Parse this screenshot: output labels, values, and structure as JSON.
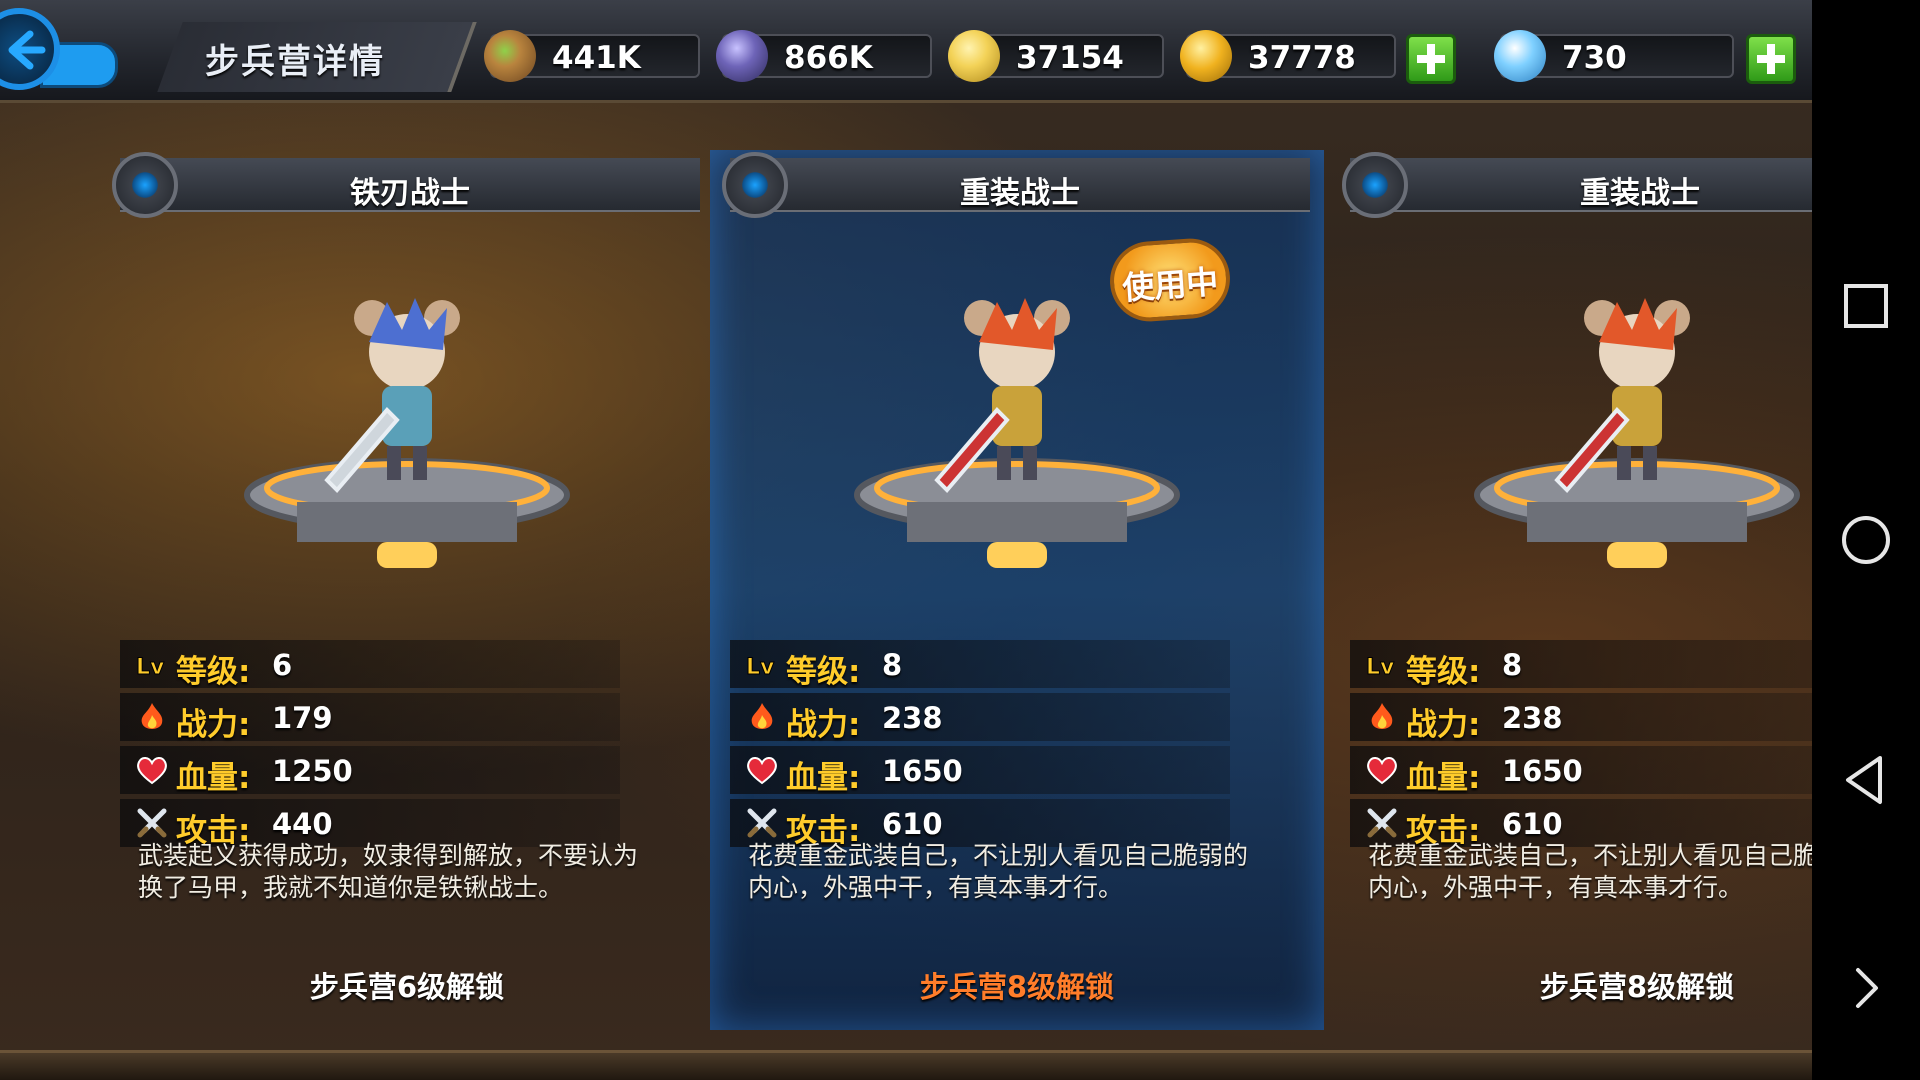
{
  "header": {
    "title": "步兵营详情"
  },
  "resources": [
    {
      "name": "wood",
      "value": "441K",
      "color": "#b9843e"
    },
    {
      "name": "ore",
      "value": "866K",
      "color": "#6e64b8"
    },
    {
      "name": "cheese",
      "value": "37154",
      "color": "#f3d257"
    },
    {
      "name": "gold",
      "value": "37778",
      "color": "#f0b21f"
    },
    {
      "name": "diamond",
      "value": "730",
      "color": "#7fd0ff"
    }
  ],
  "cards": [
    {
      "name": "铁刃战士",
      "in_use": false,
      "stats": [
        {
          "icon": "level-icon",
          "label": "等级",
          "value": "6"
        },
        {
          "icon": "flame-icon",
          "label": "战力",
          "value": "179"
        },
        {
          "icon": "heart-icon",
          "label": "血量",
          "value": "1250"
        },
        {
          "icon": "swords-icon",
          "label": "攻击",
          "value": "440"
        }
      ],
      "description": "武装起义获得成功，奴隶得到解放，不要认为换了马甲，我就不知道你是铁锹战士。",
      "unlock": "步兵营6级解锁"
    },
    {
      "name": "重装战士",
      "in_use": true,
      "in_use_label": "使用中",
      "stats": [
        {
          "icon": "level-icon",
          "label": "等级",
          "value": "8"
        },
        {
          "icon": "flame-icon",
          "label": "战力",
          "value": "238"
        },
        {
          "icon": "heart-icon",
          "label": "血量",
          "value": "1650"
        },
        {
          "icon": "swords-icon",
          "label": "攻击",
          "value": "610"
        }
      ],
      "description": "花费重金武装自己，不让别人看见自己脆弱的内心，外强中干，有真本事才行。",
      "unlock": "步兵营8级解锁"
    },
    {
      "name": "重装战士",
      "in_use": false,
      "stats": [
        {
          "icon": "level-icon",
          "label": "等级",
          "value": "8"
        },
        {
          "icon": "flame-icon",
          "label": "战力",
          "value": "238"
        },
        {
          "icon": "heart-icon",
          "label": "血量",
          "value": "1650"
        },
        {
          "icon": "swords-icon",
          "label": "攻击",
          "value": "610"
        }
      ],
      "description": "花费重金武装自己，不让别人看见自己脆弱的内心，外强中干，有真本事才行。",
      "unlock": "步兵营8级解锁"
    }
  ],
  "level_badge": "Lv",
  "colon": ":",
  "nav": {
    "icons": [
      "recent-apps-icon",
      "home-icon",
      "back-icon",
      "expand-icon"
    ]
  },
  "colors": {
    "stat_label": "#ffcc2b",
    "unlock_highlight": "#ff7d2a",
    "selected_card": "#0f4682"
  }
}
